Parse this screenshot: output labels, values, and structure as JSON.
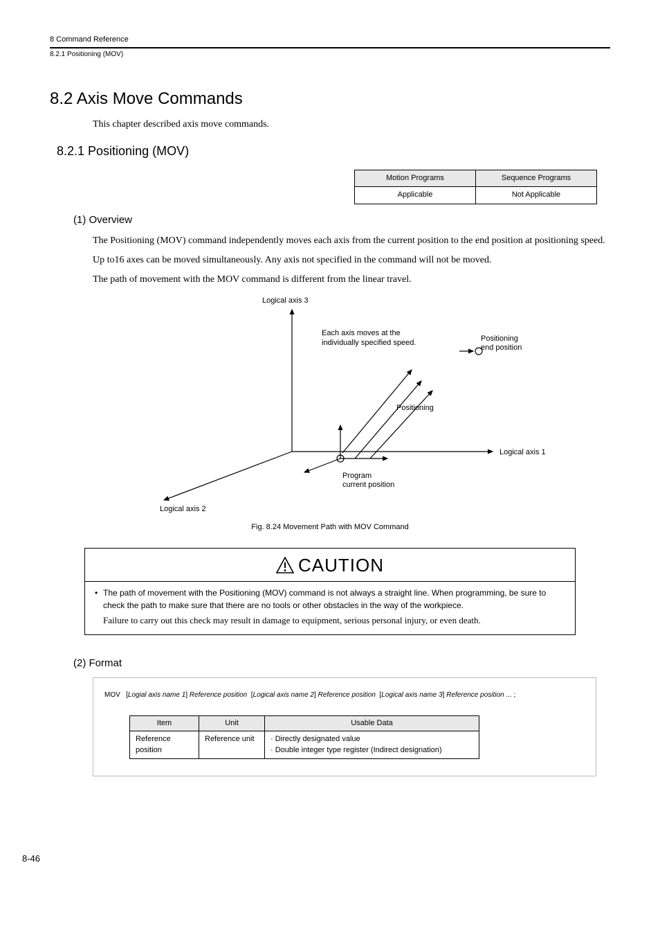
{
  "header": {
    "chapter": "8  Command Reference",
    "subsection": "8.2.1  Positioning (MOV)"
  },
  "section": {
    "title": "8.2  Axis Move Commands",
    "intro": "This chapter described axis move commands."
  },
  "subsection": {
    "title": "8.2.1  Positioning (MOV)"
  },
  "applicability": {
    "col1": "Motion Programs",
    "col2": "Sequence Programs",
    "val1": "Applicable",
    "val2": "Not Applicable"
  },
  "overview": {
    "title": "(1) Overview",
    "para1": "The Positioning (MOV) command independently moves each axis from the current position to the end position at positioning speed.",
    "para2": "Up to16 axes can be moved simultaneously. Any axis not specified in the command will not be moved.",
    "para3": "The path of movement with the MOV command is different from the linear travel."
  },
  "diagram": {
    "axis3": "Logical axis 3",
    "axis1": "Logical axis 1",
    "axis2": "Logical axis 2",
    "each_line1": "Each axis moves at the",
    "each_line2": "individually specified speed.",
    "endpos1": "Positioning",
    "endpos2": "end position",
    "positioning": "Positioning",
    "prog1": "Program",
    "prog2": "current position",
    "caption": "Fig. 8.24  Movement Path with MOV Command"
  },
  "caution": {
    "header": "CAUTION",
    "body1": "The path of movement with the Positioning (MOV) command is not always a straight line. When programming, be sure to check the path to make sure that there are no tools or other obstacles in the way of the workpiece.",
    "body2": "Failure to carry out this check may result in damage to equipment, serious personal injury, or even death."
  },
  "format": {
    "title": "(2) Format",
    "line_mov": "MOV",
    "axis1": "Logial axis name 1",
    "axis2": "Logical axis name 2",
    "axis3": "Logical axis name 3",
    "refpos": "Reference position",
    "ellipsis": "...",
    "semi": ";",
    "th_item": "Item",
    "th_unit": "Unit",
    "th_usable": "Usable Data",
    "row_item": "Reference position",
    "row_unit": "Reference unit",
    "row_usable1": "· Directly designated value",
    "row_usable2": "· Double integer type register (Indirect designation)"
  },
  "page_number": "8-46"
}
